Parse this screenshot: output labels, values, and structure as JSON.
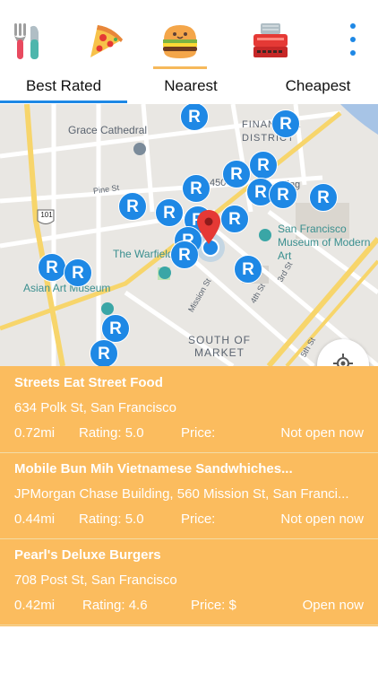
{
  "categories": [
    {
      "name": "all",
      "icon": "fork-knife-icon"
    },
    {
      "name": "pizza",
      "icon": "pizza-icon"
    },
    {
      "name": "burger",
      "icon": "burger-icon",
      "active": true
    },
    {
      "name": "dessert",
      "icon": "cake-icon"
    }
  ],
  "tabs": [
    "Best Rated",
    "Nearest",
    "Cheapest"
  ],
  "map": {
    "labels": {
      "grace_cathedral": "Grace Cathedral",
      "financial_district": "FINANCIAL DISTRICT",
      "pine_st": "Pine St",
      "highway_101": "101",
      "the_warfield": "The Warfield",
      "sfmoma": "San Francisco Museum of Modern Art",
      "asian_art_museum": "Asian Art Museum",
      "mission_st": "Mission St",
      "fourth_st": "4th St",
      "third_st": "3rd St",
      "south_of_market": "SOUTH OF MARKET",
      "fifth_st": "5th St",
      "partial_450": "450",
      "partial_ling": "ling"
    },
    "marker_letter": "R"
  },
  "results": [
    {
      "name": "Streets Eat Street Food",
      "address": "634 Polk St, San Francisco",
      "distance": "0.72mi",
      "rating": "Rating: 5.0",
      "price": "Price:",
      "status": "Not open now"
    },
    {
      "name": "Mobile Bun Mih Vietnamese Sandwhiches...",
      "address": "JPMorgan Chase Building, 560 Mission St, San Franci...",
      "distance": "0.44mi",
      "rating": "Rating: 5.0",
      "price": "Price:",
      "status": "Not open now"
    },
    {
      "name": "Pearl's Deluxe Burgers",
      "address": "708 Post St, San Francisco",
      "distance": "0.42mi",
      "rating": "Rating: 4.6",
      "price": "Price: $",
      "status": "Open now"
    }
  ]
}
